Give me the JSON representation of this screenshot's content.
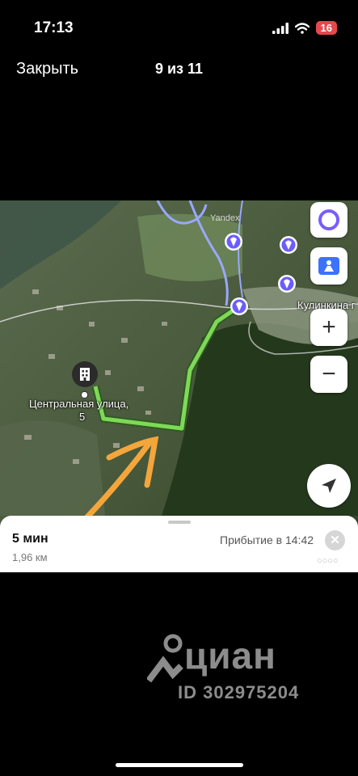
{
  "status": {
    "time": "17:13",
    "battery": "16"
  },
  "nav": {
    "close_label": "Закрыть",
    "counter": "9 из 11"
  },
  "map": {
    "building_label_line1": "Центральная улица,",
    "building_label_line2": "5",
    "place_label": "Кулинкина г",
    "provider_label": "Yandex",
    "route_color": "#7ed957",
    "river_color": "#9aa7ff",
    "highlight_color": "#f4a63b"
  },
  "route": {
    "duration": "5 мин",
    "distance": "1,96 км",
    "arrival": "Прибытие в 14:42"
  },
  "watermark": {
    "brand": "циан",
    "listing_id": "ID 302975204"
  },
  "icons": [
    "signal-icon",
    "wifi-icon",
    "alice-icon",
    "layers-icon",
    "plus-icon",
    "minus-icon",
    "locate-icon",
    "building-icon",
    "poi-icon",
    "close-icon"
  ]
}
